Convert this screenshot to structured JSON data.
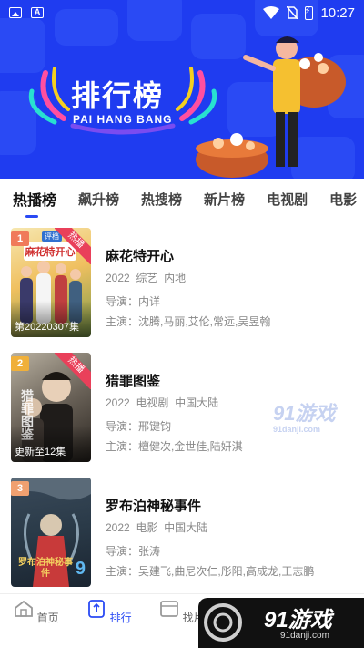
{
  "status_bar": {
    "time": "10:27"
  },
  "banner": {
    "title": "排行榜",
    "subtitle": "PAI HANG BANG"
  },
  "tabs": [
    "热播榜",
    "飙升榜",
    "热搜榜",
    "新片榜",
    "电视剧",
    "电影"
  ],
  "items": [
    {
      "rank": "1",
      "title": "麻花特开心",
      "year": "2022",
      "type": "综艺",
      "region": "内地",
      "director": "导演：内详",
      "cast": "主演：沈腾,马丽,艾伦,常远,吴昱翰",
      "hot_badge": "热播",
      "episode_label": "第20220307集",
      "poster_text": "麻花特开心",
      "poster_tag": "评档",
      "rank_color": "#f07a5a"
    },
    {
      "rank": "2",
      "title": "猎罪图鉴",
      "year": "2022",
      "type": "电视剧",
      "region": "中国大陆",
      "director": "导演：邢键钧",
      "cast": "主演：檀健次,金世佳,陆妍淇",
      "hot_badge": "热播",
      "episode_label": "更新至12集",
      "poster_text": "猎罪图鉴",
      "rank_color": "#f0b03a"
    },
    {
      "rank": "3",
      "title": "罗布泊神秘事件",
      "year": "2022",
      "type": "电影",
      "region": "中国大陆",
      "director": "导演：张涛",
      "cast": "主演：吴建飞,曲尼次仁,彤阳,高成龙,王志鹏",
      "poster_text": "罗布泊神秘事件",
      "poster_num": "9",
      "rank_color": "#f0a070"
    }
  ],
  "nav": [
    "首页",
    "排行",
    "找片"
  ],
  "watermarks": {
    "mid": "91游戏",
    "mid_url": "91danji.com",
    "corner": "91游戏",
    "corner_url": "91danji.com"
  }
}
